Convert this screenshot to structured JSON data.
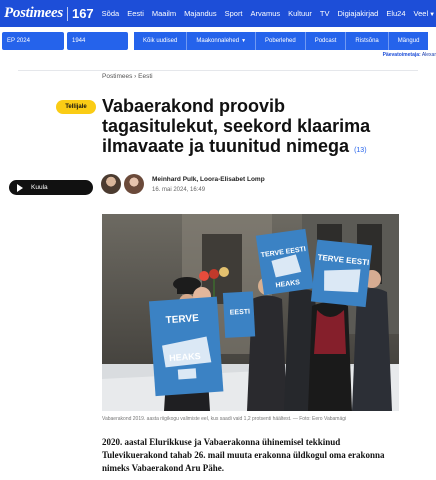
{
  "header": {
    "logo": "Postimees",
    "logo_number": "167",
    "nav": [
      "Sõda",
      "Eesti",
      "Maailm",
      "Majandus",
      "Sport",
      "Arvamus",
      "Kultuur",
      "TV",
      "Digiajakirjad",
      "Elu24",
      "Veel"
    ],
    "brand_color": "#1d4ed8"
  },
  "subbar": {
    "tile1": "EP 2024",
    "tile2": "1944",
    "tabs": [
      "Kõik uudised",
      "Maakonnalehed",
      "Poberlehed",
      "Podcast",
      "Ristsõna",
      "Mängud"
    ],
    "ticker_label": "Päevatoimetaja:",
    "ticker_name": "Alexar"
  },
  "breadcrumb": [
    "Postimees",
    "Eesti"
  ],
  "article": {
    "paywall_badge": "Tellijale",
    "title": "Vabaerakond proovib tagasitulekut, seekord klaarima ilmavaate ja tuunitud nimega",
    "comment_count": "(13)",
    "listen_label": "Kuula",
    "authors": "Meinhard Pulk, Loora-Elisabet Lomp",
    "date": "16. mai 2024, 16:49",
    "photo_caption": "Vabaerakond 2019. aasta riigikogu valimiste eel, kus saadi vaid 1,2 protsenti häältest. — Foto: Eero Vabamägi",
    "lead": "2020. aastal Elurikkuse ja Vabaerakonna ühinemisel tekkinud Tulevikuerakond tahab 26. mail muuta erakonna üldkogul oma erakonna nimeks Vabaerakond Aru Pähe.",
    "signs": [
      "TERVE EESTI HEAKS",
      "TERVE HEAKS",
      "EESTI"
    ]
  }
}
